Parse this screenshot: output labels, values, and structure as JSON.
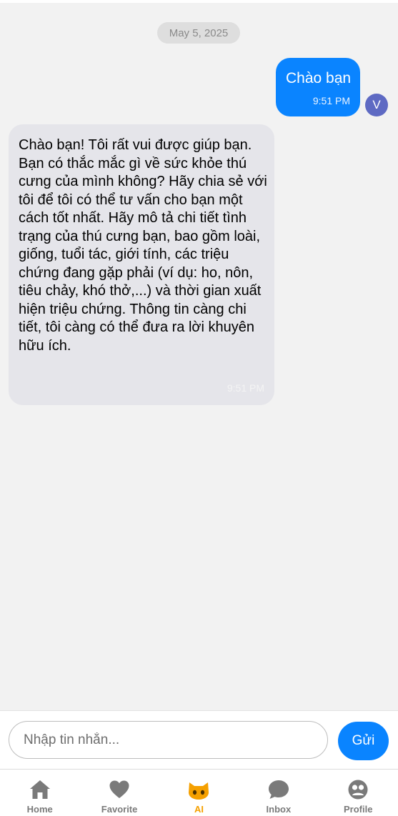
{
  "conversation": {
    "date": "May 5, 2025",
    "messages": [
      {
        "sender": "user",
        "text": "Chào bạn",
        "time": "9:51 PM",
        "avatar_initial": "V"
      },
      {
        "sender": "assistant",
        "text": "Chào bạn!  Tôi rất vui được giúp bạn. Bạn có thắc mắc gì về sức khỏe thú cưng của mình không?  Hãy chia sẻ với tôi để tôi có thể tư vấn cho bạn một cách tốt nhất.  Hãy mô tả chi tiết tình trạng của thú cưng bạn, bao gồm loài, giống, tuổi tác, giới tính, các triệu chứng đang gặp phải (ví dụ: ho, nôn, tiêu chảy, khó thở,...) và thời gian xuất hiện triệu chứng.  Thông tin càng chi tiết, tôi càng có thể đưa ra lời khuyên hữu ích.",
        "time": "9:51 PM"
      }
    ]
  },
  "composer": {
    "placeholder": "Nhập tin nhắn...",
    "value": "",
    "send_label": "Gửi"
  },
  "tabbar": {
    "active_color": "#f5a000",
    "inactive_color": "#7a7a7a",
    "items": [
      {
        "label": "Home",
        "icon": "home-icon"
      },
      {
        "label": "Favorite",
        "icon": "heart-icon"
      },
      {
        "label": "AI",
        "icon": "cat-icon",
        "active": true
      },
      {
        "label": "Inbox",
        "icon": "chat-bubble-icon"
      },
      {
        "label": "Profile",
        "icon": "profile-icon"
      }
    ]
  },
  "colors": {
    "accent": "#0a84ff",
    "avatar": "#5e6ac3",
    "incoming_bubble": "#e5e5ea",
    "background": "#f2f2f2"
  }
}
